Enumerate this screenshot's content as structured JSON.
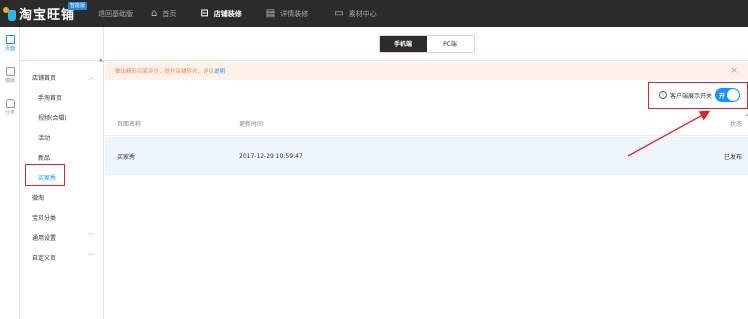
{
  "header": {
    "logo_text": "淘宝旺铺",
    "logo_badge": "智能版",
    "nav": [
      {
        "label": "退回基础版",
        "icon": "",
        "active": false
      },
      {
        "label": "首页",
        "icon": "home-icon",
        "active": false
      },
      {
        "label": "店铺装修",
        "icon": "shop-icon",
        "active": true
      },
      {
        "label": "详情装修",
        "icon": "detail-icon",
        "active": false
      },
      {
        "label": "素材中心",
        "icon": "folder-icon",
        "active": false
      }
    ]
  },
  "rail": {
    "items": [
      {
        "label": "页面",
        "icon": "page-icon",
        "active": true
      },
      {
        "label": "模版",
        "icon": "template-icon",
        "active": false
      },
      {
        "label": "分类",
        "icon": "category-icon",
        "active": false
      }
    ]
  },
  "sidebar": {
    "items": [
      {
        "label": "店铺首页",
        "chevron": "︿",
        "sub": false,
        "selected": false
      },
      {
        "label": "手淘首页",
        "chevron": "",
        "sub": true,
        "selected": false
      },
      {
        "label": "视频(合辑)",
        "chevron": "",
        "sub": true,
        "selected": false
      },
      {
        "label": "活动",
        "chevron": "",
        "sub": true,
        "selected": false
      },
      {
        "label": "新品",
        "chevron": "",
        "sub": true,
        "selected": false
      },
      {
        "label": "买家秀",
        "chevron": "",
        "sub": true,
        "selected": true
      },
      {
        "label": "微淘",
        "chevron": "",
        "sub": false,
        "selected": false
      },
      {
        "label": "宝贝分类",
        "chevron": "",
        "sub": false,
        "selected": false
      },
      {
        "label": "通用设置",
        "chevron": "﹀",
        "sub": false,
        "selected": false
      },
      {
        "label": "自定义页",
        "chevron": "﹀",
        "sub": false,
        "selected": false
      }
    ]
  },
  "segment": {
    "mobile_label": "手机端",
    "pc_label": "PC端"
  },
  "notice": {
    "text": "推出精彩买家评价，提升店铺转化，详见",
    "link": "说明",
    "close": "×"
  },
  "toggle": {
    "info": "i",
    "label": "客户端展示开关",
    "state": "开"
  },
  "table": {
    "headers": {
      "name": "页面名称",
      "time": "更新时间",
      "status": "状态"
    },
    "rows": [
      {
        "name": "买家秀",
        "time": "2017-12-29 10:59:47",
        "status": "已发布"
      }
    ]
  },
  "colors": {
    "accent": "#1890ff",
    "highlight": "#e0242b",
    "topbar": "#2b2b2b"
  }
}
